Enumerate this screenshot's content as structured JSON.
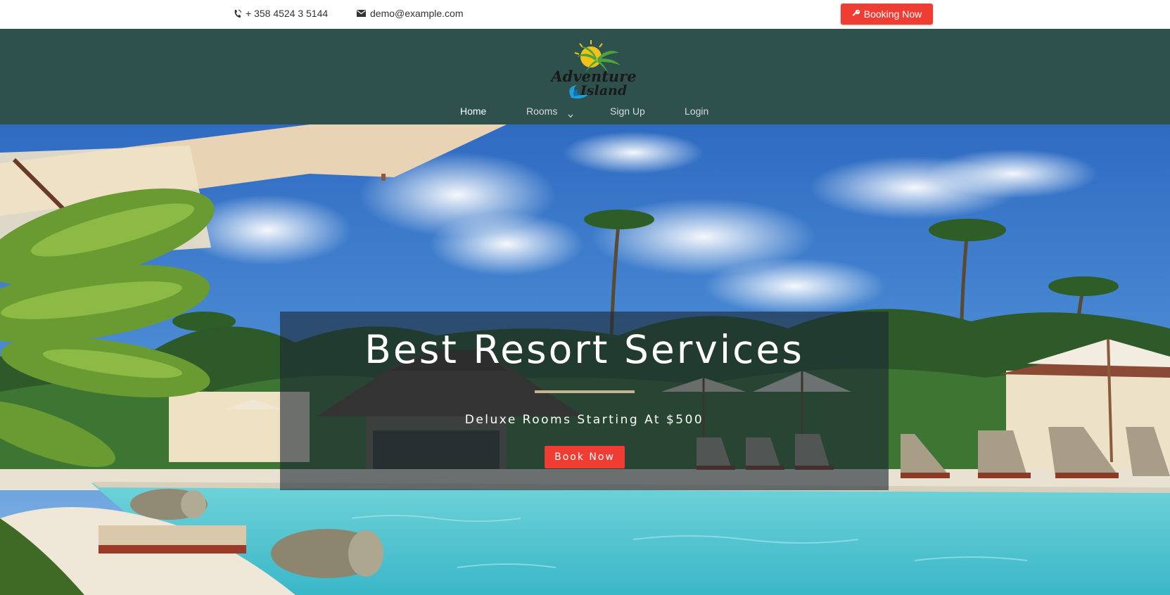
{
  "topbar": {
    "phone": "+ 358 4524 3 5144",
    "email": "demo@example.com",
    "booking_label": "Booking Now"
  },
  "header": {
    "logo_text": [
      "Adventure",
      "Island"
    ]
  },
  "nav": {
    "items": [
      {
        "label": "Home",
        "active": true
      },
      {
        "label": "Rooms",
        "has_dropdown": true
      },
      {
        "label": "Sign Up"
      },
      {
        "label": "Login"
      }
    ]
  },
  "hero": {
    "title": "Best Resort Services",
    "subtitle": "Deluxe Rooms Starting At $500",
    "button_label": "Book Now"
  },
  "colors": {
    "accent": "#f03d33",
    "header_bg": "#2e514e",
    "divider": "#c9b28e"
  },
  "icons": [
    "phone-icon",
    "envelope-icon",
    "key-icon",
    "chevron-down-icon"
  ]
}
